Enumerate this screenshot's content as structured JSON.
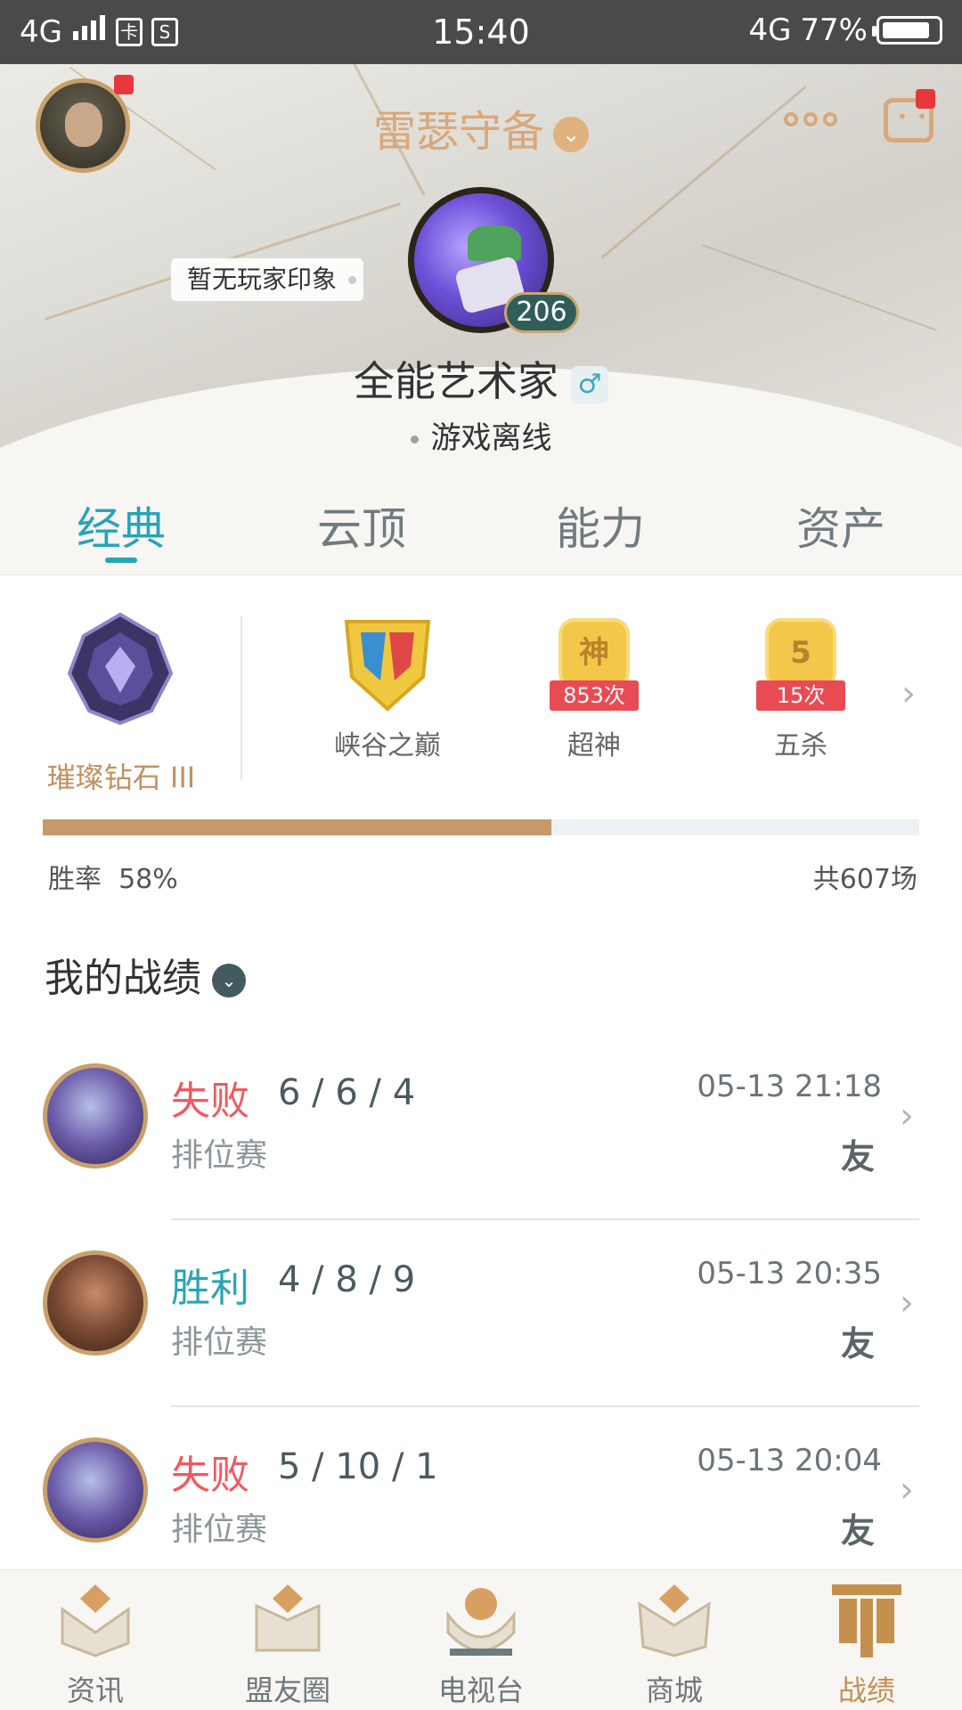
{
  "status_bar": {
    "network": "4G",
    "time": "15:40",
    "net_right": "4G",
    "battery": "77%"
  },
  "header": {
    "title": "雷瑟守备",
    "impression": "暂无玩家印象",
    "level": "206",
    "player_name": "全能艺术家",
    "gender_symbol": "♂",
    "online_status": "游戏离线"
  },
  "tabs": [
    {
      "label": "经典",
      "active": true
    },
    {
      "label": "云顶",
      "active": false
    },
    {
      "label": "能力",
      "active": false
    },
    {
      "label": "资产",
      "active": false
    }
  ],
  "rank": {
    "label": "璀璨钻石 III"
  },
  "achievements": [
    {
      "label": "峡谷之巅",
      "icon": "summit-badge-icon"
    },
    {
      "label": "超神",
      "badge_char": "神",
      "count": "853次",
      "icon": "legendary-badge-icon"
    },
    {
      "label": "五杀",
      "badge_char": "5",
      "count": "15次",
      "icon": "pentakill-badge-icon"
    }
  ],
  "stats": {
    "winrate_label": "胜率",
    "winrate_value": "58%",
    "winrate_fraction": 0.58,
    "total": "共607场"
  },
  "section": {
    "title": "我的战绩"
  },
  "matches": [
    {
      "result": "失败",
      "outcome": "loss",
      "kda": "6 / 6 / 4",
      "mode": "排位赛",
      "time": "05-13 21:18",
      "tag": "友",
      "champion_icon": "evelynn-portrait-icon"
    },
    {
      "result": "胜利",
      "outcome": "win",
      "kda": "4 / 8 / 9",
      "mode": "排位赛",
      "time": "05-13 20:35",
      "tag": "友",
      "champion_icon": "lucian-portrait-icon"
    },
    {
      "result": "失败",
      "outcome": "loss",
      "kda": "5 / 10 / 1",
      "mode": "排位赛",
      "time": "05-13 20:04",
      "tag": "友",
      "champion_icon": "evelynn-portrait-icon"
    }
  ],
  "bottom_nav": [
    {
      "label": "资讯",
      "active": false
    },
    {
      "label": "盟友圈",
      "active": false
    },
    {
      "label": "电视台",
      "active": false
    },
    {
      "label": "商城",
      "active": false
    },
    {
      "label": "战绩",
      "active": true
    }
  ],
  "colors": {
    "accent": "#27a5b5",
    "gold": "#c59a6a",
    "loss": "#f0595e",
    "win": "#27a5b5"
  }
}
